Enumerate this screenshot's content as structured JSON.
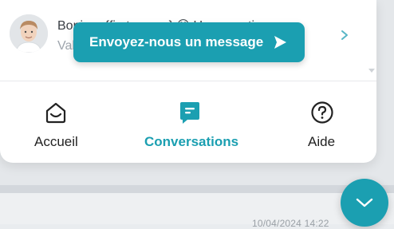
{
  "conversation": {
    "preview_text": "Bonjour {first_name} 😊 Une question ou...",
    "sender_name": "Val",
    "avatar_icon": "person-avatar"
  },
  "cta": {
    "label": "Envoyez-nous un message",
    "icon": "send-icon"
  },
  "nav": {
    "home_label": "Accueil",
    "conversations_label": "Conversations",
    "help_label": "Aide"
  },
  "background": {
    "date_text": "10/04/2024 14:22"
  },
  "colors": {
    "accent": "#1b9fb1",
    "text_dark": "#222222",
    "text_muted": "#9ea5ad"
  }
}
